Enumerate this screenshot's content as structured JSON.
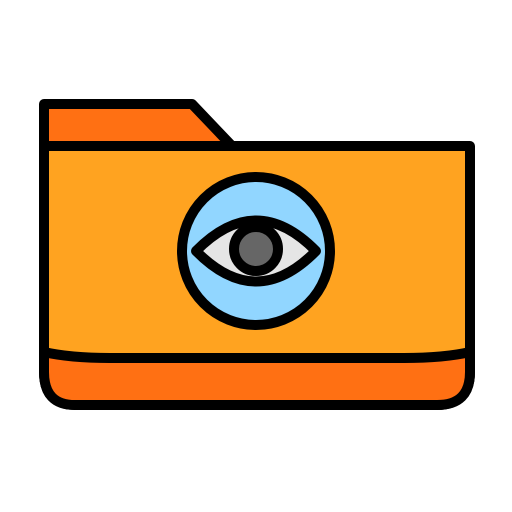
{
  "icon": {
    "name": "folder-eye-icon",
    "parts": {
      "folder": "folder-icon",
      "eye": "eye-icon"
    },
    "colors": {
      "outline": "#000000",
      "folder_tab": "#FF7013",
      "folder_body": "#FFA320",
      "folder_bottom_band": "#FF7013",
      "lens_background": "#91D6FF",
      "eye_white": "#E5E5E5",
      "pupil": "#666666"
    }
  }
}
